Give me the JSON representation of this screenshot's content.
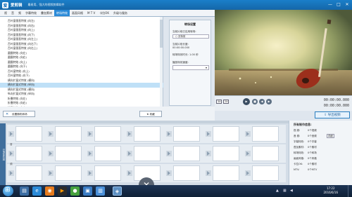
{
  "app": {
    "title": "爱剪辑",
    "subtitle": "最易用、强大的视频剪辑软件",
    "logo_text": "爱",
    "controls": [
      "—",
      "□",
      "✕"
    ]
  },
  "tabs": [
    {
      "label": "视",
      "active": false
    },
    {
      "label": "音",
      "active": false
    },
    {
      "label": "频",
      "active": false
    },
    {
      "label": "字幕特效",
      "active": false
    },
    {
      "label": "叠加素材",
      "active": false
    },
    {
      "label": "转场特效",
      "active": true
    },
    {
      "label": "画面风格",
      "active": false
    },
    {
      "label": "M T V",
      "active": false
    },
    {
      "label": "卡拉OK",
      "active": false
    },
    {
      "label": "升级与服务",
      "active": false
    }
  ],
  "effects": [
    {
      "label": "百叶窗垂直特效 (向左)",
      "selected": false
    },
    {
      "label": "百叶窗垂直特效 (向右)",
      "selected": false
    },
    {
      "label": "百叶窗垂直特效 (向上)",
      "selected": false
    },
    {
      "label": "百叶窗垂直特效 (向下)",
      "selected": false
    },
    {
      "label": "百叶窗垂直特效 (向左上)",
      "selected": false
    },
    {
      "label": "百叶窗垂直特效 (向右下)",
      "selected": false
    },
    {
      "label": "百叶窗垂直特效 (向右上)",
      "selected": false
    },
    {
      "label": "圆圈特效 (向左)",
      "selected": false
    },
    {
      "label": "圆圈特效 (向右)",
      "selected": false
    },
    {
      "label": "圆圈特效 (向上)",
      "selected": false
    },
    {
      "label": "圆圈特效 (向下)",
      "selected": false
    },
    {
      "label": "百叶窗特效 (向上)",
      "selected": false
    },
    {
      "label": "百叶窗特效 (向下)",
      "selected": false
    },
    {
      "label": "横向扩展式特效 (横向)",
      "selected": false
    },
    {
      "label": "横向扩展式特效 (纵向)",
      "selected": true
    },
    {
      "label": "横向扩展式特效 (横向)",
      "selected": false
    },
    {
      "label": "纵向扩展式特效 (纵向)",
      "selected": false
    },
    {
      "label": "折叠特效 (向左)",
      "selected": false
    },
    {
      "label": "折叠特效 (向右)",
      "selected": false
    },
    {
      "label": "折叠特效 (向上)",
      "selected": false
    },
    {
      "label": "折叠特效 (向下)",
      "selected": false
    },
    {
      "label": "折叠特效 (水平)",
      "selected": false
    },
    {
      "label": "折叠特效 (垂直)",
      "selected": false
    }
  ],
  "settings": {
    "title": "转场设置",
    "apply_label": "应用/修改",
    "random_label": "随机转场",
    "current_effect_label": "当前片段已应用转场:",
    "current_effect_value": "无特效",
    "duration_label": "当前片段长度:",
    "duration_value": "00:00:00.000",
    "speed_label": "转场特效时长:",
    "speed_value": "1.00 秒",
    "mode_label": "播放特效速度:"
  },
  "actions": {
    "all_effects": "设置随机转场",
    "collect": "收藏"
  },
  "player": {
    "ratio_labels": [
      "3X",
      "2X"
    ],
    "time_current": "00:00:00.000",
    "time_total": "00:00:00.000",
    "export": "导出视频"
  },
  "timeline": {
    "side_label": "已添加片段",
    "track_labels": [
      "音",
      "频"
    ]
  },
  "info": {
    "title": "所有制作信息:",
    "rows": [
      {
        "k": "视 频:",
        "v": "0个视频"
      },
      {
        "k": "音 频:",
        "v": "0个音频",
        "extra": "详细"
      },
      {
        "k": "字幕特效:",
        "v": "0个字幕"
      },
      {
        "k": "叠加素材:",
        "v": "0个素材"
      },
      {
        "k": "转场特效:",
        "v": "0个转场"
      },
      {
        "k": "画面风格:",
        "v": "0个风格"
      },
      {
        "k": "卡拉OK:",
        "v": "0个素材"
      },
      {
        "k": "MTV:",
        "v": "0个MTV"
      }
    ]
  },
  "taskbar": {
    "time": "17:22",
    "date": "2016/6/16"
  }
}
